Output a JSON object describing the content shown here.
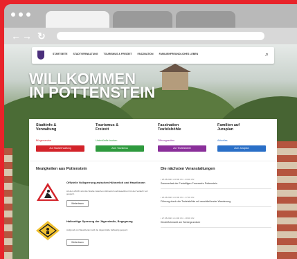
{
  "colors": {
    "brand_purple": "#4b2f7c",
    "red": "#d3232a",
    "green": "#2e9a3e",
    "purple": "#8a2f9a",
    "blue": "#2a6fc7",
    "frame": "#e8232a"
  },
  "browser": {
    "back_icon": "arrow-left-icon",
    "forward_icon": "arrow-right-icon",
    "reload_icon": "reload-icon"
  },
  "site_nav": {
    "items": [
      "STARTSEITE",
      "STADTVERWALTUNG",
      "TOURISMUS & FREIZEIT",
      "FASZINATION",
      "FAMILIENFREUNDLICHES LEBEN",
      "SONSTIGES"
    ]
  },
  "hero": {
    "line1": "WILLKOMMEN",
    "line2": "IN POTTENSTEIN"
  },
  "categories": [
    {
      "title": "Stadtinfo &\nVerwaltung",
      "sub": "Bürgerservice",
      "button": "Zur Stadtverwaltung",
      "color": "#d3232a"
    },
    {
      "title": "Tourismus &\nFreizeit",
      "sub": "Unterkünfte buchen",
      "button": "Zum Tourismus",
      "color": "#2e9a3e"
    },
    {
      "title": "Faszination\nTeufelshöhle",
      "sub": "Öffnungszeiten",
      "button": "Zur Teufelshöhle",
      "color": "#8a2f9a"
    },
    {
      "title": "Familien auf\nJuraplan",
      "sub": "Aktuelles",
      "button": "Zum Juraplan",
      "color": "#2a6fc7"
    }
  ],
  "news": {
    "title": "Neuigkeiten aus Pottenstein",
    "items": [
      {
        "title": "Offizielle Vollsperrung zwischen Hühnerloh und Haselbrunn",
        "text": "Ab dem 28.08. wird die Straße zwischen Hühnerloh und Haselbrunn für den Verkehr voll gesperrt.",
        "button": "Weiterlesen",
        "icon": "construction-sign-icon"
      },
      {
        "title": "Halbseitige Sperrung der Jägerstraße, Begegnung",
        "text": "Aufgrund von Bauarbeiten wird die Jägerstraße halbseitig gesperrt.",
        "button": "Weiterlesen",
        "icon": "warning-sign-icon"
      }
    ]
  },
  "events": {
    "title": "Die nächsten Veranstaltungen",
    "items": [
      {
        "meta": "▪ 25.08.2023  ▪ 18:00 Uhr - 23:00 Uhr",
        "title": "Sommerfest der Freiwilligen Feuerwehr Pottenstein"
      },
      {
        "meta": "▪ 26.08.2023  ▪ 10:00 Uhr - 17:00 Uhr",
        "title": "Führung durch die Teufelshöhle mit anschließender Wanderung"
      },
      {
        "meta": "▪ 27.08.2023  ▪ 14:00 Uhr - 18:00 Uhr",
        "title": "Kinderflohmarkt am Schöngrundsee"
      }
    ]
  }
}
